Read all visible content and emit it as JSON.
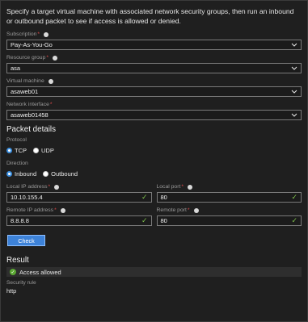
{
  "intro_text": "Specify a target virtual machine with associated network security groups, then run an inbound or outbound packet to see if access is allowed or denied.",
  "fields": {
    "subscription": {
      "label": "Subscription",
      "value": "Pay-As-You-Go"
    },
    "resource_group": {
      "label": "Resource group",
      "value": "asa"
    },
    "virtual_machine": {
      "label": "Virtual machine",
      "value": "asaweb01"
    },
    "network_interface": {
      "label": "Network interface",
      "value": "asaweb01458"
    }
  },
  "packet_details": {
    "title": "Packet details",
    "protocol": {
      "label": "Protocol",
      "options": [
        "TCP",
        "UDP"
      ],
      "selected": "TCP"
    },
    "direction": {
      "label": "Direction",
      "options": [
        "Inbound",
        "Outbound"
      ],
      "selected": "Inbound"
    },
    "local_ip": {
      "label": "Local IP address",
      "value": "10.10.155.4"
    },
    "local_port": {
      "label": "Local port",
      "value": "80"
    },
    "remote_ip": {
      "label": "Remote IP address",
      "value": "8.8.8.8"
    },
    "remote_port": {
      "label": "Remote port",
      "value": "80"
    }
  },
  "check_button": "Check",
  "result": {
    "title": "Result",
    "status": "Access allowed",
    "security_rule_label": "Security rule",
    "security_rule_value": "http"
  },
  "colors": {
    "accent": "#3d82d8",
    "success": "#5aa732",
    "required": "#e04b4b"
  },
  "icons": [
    "chevron-down-icon",
    "info-icon",
    "checkmark-icon",
    "success-circle-icon"
  ]
}
